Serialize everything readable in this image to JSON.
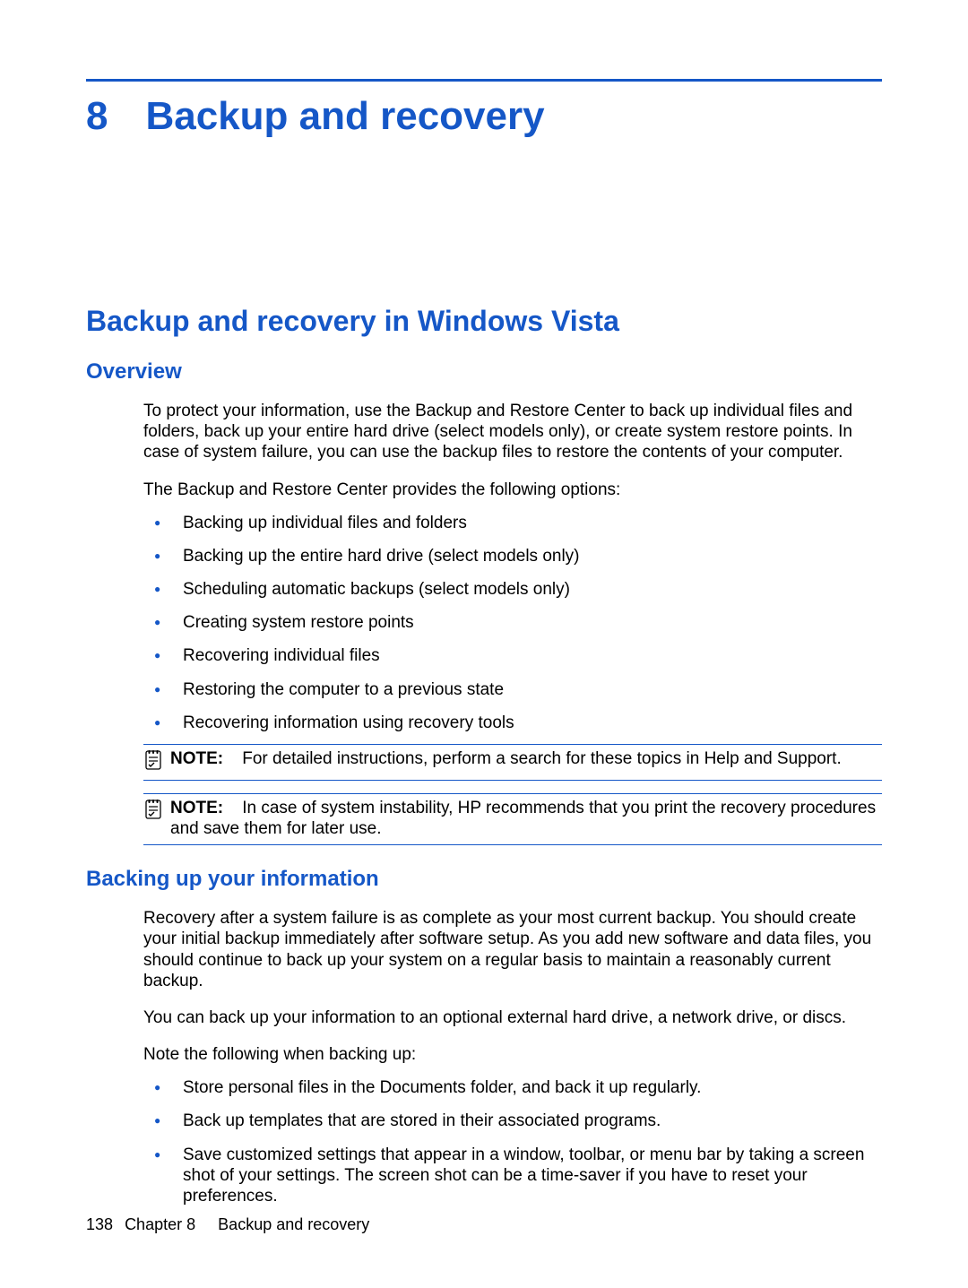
{
  "chapter": {
    "number": "8",
    "title": "Backup and recovery"
  },
  "section": {
    "title": "Backup and recovery in Windows Vista"
  },
  "overview": {
    "heading": "Overview",
    "para1": "To protect your information, use the Backup and Restore Center to back up individual files and folders, back up your entire hard drive (select models only), or create system restore points. In case of system failure, you can use the backup files to restore the contents of your computer.",
    "para2": "The Backup and Restore Center provides the following options:",
    "bullets": [
      "Backing up individual files and folders",
      "Backing up the entire hard drive (select models only)",
      "Scheduling automatic backups (select models only)",
      "Creating system restore points",
      "Recovering individual files",
      "Restoring the computer to a previous state",
      "Recovering information using recovery tools"
    ],
    "note1": {
      "label": "NOTE:",
      "text": "For detailed instructions, perform a search for these topics in Help and Support."
    },
    "note2": {
      "label": "NOTE:",
      "text": "In case of system instability, HP recommends that you print the recovery procedures and save them for later use."
    }
  },
  "backing_up": {
    "heading": "Backing up your information",
    "para1": "Recovery after a system failure is as complete as your most current backup. You should create your initial backup immediately after software setup. As you add new software and data files, you should continue to back up your system on a regular basis to maintain a reasonably current backup.",
    "para2": "You can back up your information to an optional external hard drive, a network drive, or discs.",
    "para3": "Note the following when backing up:",
    "bullets": [
      "Store personal files in the Documents folder, and back it up regularly.",
      "Back up templates that are stored in their associated programs.",
      "Save customized settings that appear in a window, toolbar, or menu bar by taking a screen shot of your settings. The screen shot can be a time-saver if you have to reset your preferences."
    ]
  },
  "footer": {
    "page_number": "138",
    "chapter_label": "Chapter 8",
    "chapter_title": "Backup and recovery"
  }
}
